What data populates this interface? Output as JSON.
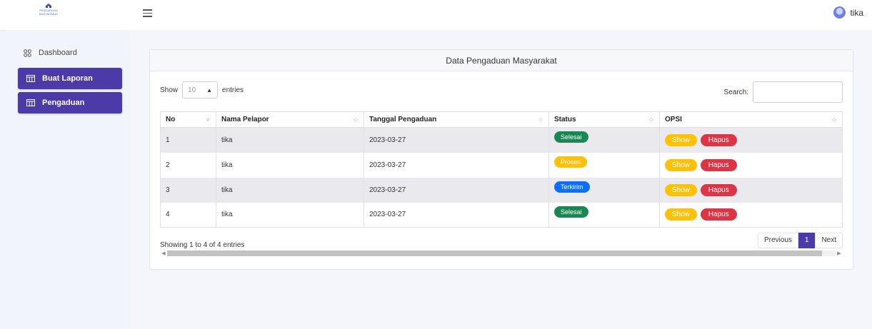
{
  "header": {
    "logo_text": "PENGADUAN MASYARAKAT",
    "menu_icon": "hamburger-icon",
    "user_name": "tika"
  },
  "sidebar": {
    "dashboard_label": "Dashboard",
    "items": [
      {
        "label": "Buat Laporan",
        "icon": "table-icon"
      },
      {
        "label": "Pengaduan",
        "icon": "table-icon"
      }
    ],
    "accent": "#4b3aa8"
  },
  "card": {
    "title": "Data Pengaduan Masyarakat"
  },
  "controls": {
    "show_label": "Show",
    "length_value": "10",
    "entries_label": "entries",
    "search_label": "Search:",
    "search_value": ""
  },
  "table": {
    "columns": [
      "No",
      "Nama Pelapor",
      "Tanggal Pengaduan",
      "Status",
      "OPSI"
    ],
    "rows": [
      {
        "no": "1",
        "nama": "tika",
        "tanggal": "2023-03-27",
        "status": "Selesai",
        "show": "Show",
        "hapus": "Hapus"
      },
      {
        "no": "2",
        "nama": "tika",
        "tanggal": "2023-03-27",
        "status": "Proses",
        "show": "Show",
        "hapus": "Hapus"
      },
      {
        "no": "3",
        "nama": "tika",
        "tanggal": "2023-03-27",
        "status": "Terkirim",
        "show": "Show",
        "hapus": "Hapus"
      },
      {
        "no": "4",
        "nama": "tika",
        "tanggal": "2023-03-27",
        "status": "Selesai",
        "show": "Show",
        "hapus": "Hapus"
      }
    ],
    "status_colors": {
      "Selesai": "#198754",
      "Proses": "#ffc107",
      "Terkirim": "#0d6efd"
    }
  },
  "footer": {
    "info": "Showing 1 to 4 of 4 entries",
    "prev_label": "Previous",
    "page": "1",
    "next_label": "Next"
  }
}
